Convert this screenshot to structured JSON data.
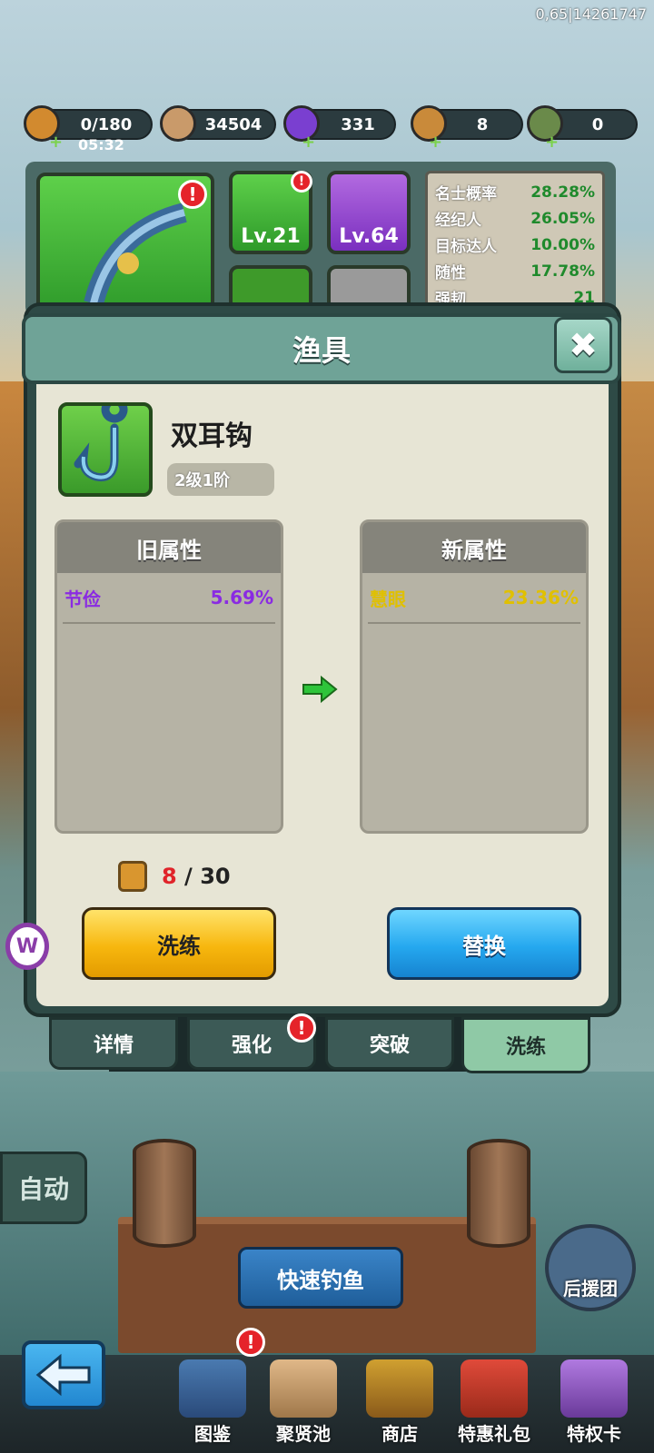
{
  "debug_info": "0,65|14261747",
  "resources": {
    "stamina": {
      "value": "0/180",
      "timer": "05:32"
    },
    "coins": {
      "value": "34504"
    },
    "gems": {
      "value": "331"
    },
    "tokens": {
      "value": "8"
    },
    "staff": {
      "value": "0"
    }
  },
  "equipment_slots": [
    {
      "level": "Lv.21"
    },
    {
      "level": "Lv.64"
    }
  ],
  "stats": [
    {
      "label": "名士概率",
      "value": "28.28%"
    },
    {
      "label": "经纪人",
      "value": "26.05%"
    },
    {
      "label": "目标达人",
      "value": "10.00%"
    },
    {
      "label": "随性",
      "value": "17.78%"
    },
    {
      "label": "强韧",
      "value": "21"
    }
  ],
  "modal": {
    "title": "渔具",
    "item_name": "双耳钩",
    "item_level": "2级1阶",
    "old_header": "旧属性",
    "new_header": "新属性",
    "old_attr": {
      "name": "节俭",
      "value": "5.69%",
      "color": "#8a2be2"
    },
    "new_attr": {
      "name": "慧眼",
      "value": "23.36%",
      "color": "#e0c000"
    },
    "cost_current": "8",
    "cost_sep": " / ",
    "cost_total": "30",
    "refine_button": "洗练",
    "replace_button": "替换"
  },
  "tabs": [
    "详情",
    "强化",
    "突破",
    "洗练"
  ],
  "auto_button": "自动",
  "quick_fish_button": "快速钓鱼",
  "support_label": "后援团",
  "nav": [
    "图鉴",
    "聚贤池",
    "商店",
    "特惠礼包",
    "特权卡"
  ],
  "badge_symbol": "!",
  "close_symbol": "✖",
  "colors": {
    "modal_header": "#6fa397",
    "refine": "#f7b70e",
    "replace": "#25a8ef",
    "new_value": "#e0c000"
  }
}
